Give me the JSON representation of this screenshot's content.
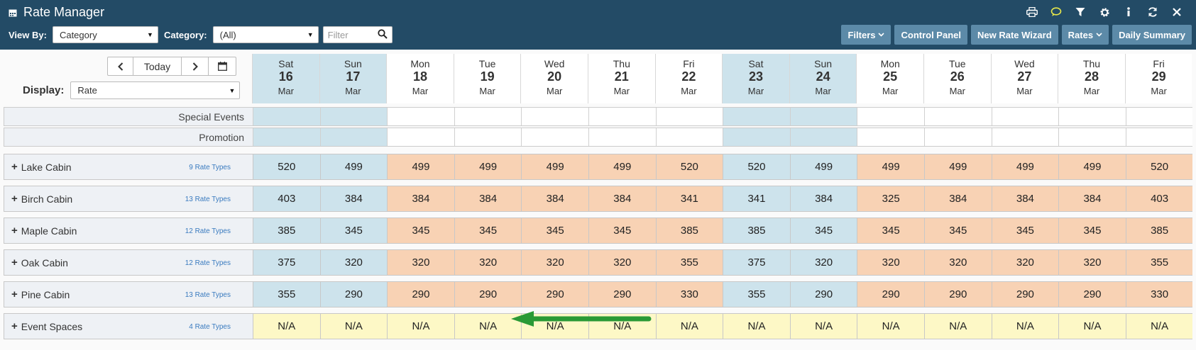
{
  "header": {
    "title": "Rate Manager",
    "view_by_label": "View By:",
    "view_by_value": "Category",
    "category_label": "Category:",
    "category_value": "(All)",
    "filter_placeholder": "Filter",
    "buttons": {
      "filters": "Filters",
      "control_panel": "Control Panel",
      "new_rate_wizard": "New Rate Wizard",
      "rates": "Rates",
      "daily_summary": "Daily Summary"
    },
    "icons": [
      "print-icon",
      "chat-icon",
      "filter-icon",
      "gear-icon",
      "info-icon",
      "refresh-icon",
      "close-icon"
    ]
  },
  "nav": {
    "today": "Today"
  },
  "display": {
    "label": "Display:",
    "value": "Rate"
  },
  "days": [
    {
      "dow": "Sat",
      "date": "16",
      "month": "Mar",
      "weekend": true
    },
    {
      "dow": "Sun",
      "date": "17",
      "month": "Mar",
      "weekend": true
    },
    {
      "dow": "Mon",
      "date": "18",
      "month": "Mar",
      "weekend": false
    },
    {
      "dow": "Tue",
      "date": "19",
      "month": "Mar",
      "weekend": false
    },
    {
      "dow": "Wed",
      "date": "20",
      "month": "Mar",
      "weekend": false
    },
    {
      "dow": "Thu",
      "date": "21",
      "month": "Mar",
      "weekend": false
    },
    {
      "dow": "Fri",
      "date": "22",
      "month": "Mar",
      "weekend": false
    },
    {
      "dow": "Sat",
      "date": "23",
      "month": "Mar",
      "weekend": true
    },
    {
      "dow": "Sun",
      "date": "24",
      "month": "Mar",
      "weekend": true
    },
    {
      "dow": "Mon",
      "date": "25",
      "month": "Mar",
      "weekend": false
    },
    {
      "dow": "Tue",
      "date": "26",
      "month": "Mar",
      "weekend": false
    },
    {
      "dow": "Wed",
      "date": "27",
      "month": "Mar",
      "weekend": false
    },
    {
      "dow": "Thu",
      "date": "28",
      "month": "Mar",
      "weekend": false
    },
    {
      "dow": "Fri",
      "date": "29",
      "month": "Mar",
      "weekend": false
    }
  ],
  "event_rows": [
    "Special Events",
    "Promotion"
  ],
  "categories": [
    {
      "name": "Lake Cabin",
      "rate_types": "9 Rate Types",
      "values": [
        "520",
        "499",
        "499",
        "499",
        "499",
        "499",
        "520",
        "520",
        "499",
        "499",
        "499",
        "499",
        "499",
        "520"
      ]
    },
    {
      "name": "Birch Cabin",
      "rate_types": "13 Rate Types",
      "values": [
        "403",
        "384",
        "384",
        "384",
        "384",
        "384",
        "341",
        "341",
        "384",
        "325",
        "384",
        "384",
        "384",
        "403"
      ]
    },
    {
      "name": "Maple Cabin",
      "rate_types": "12 Rate Types",
      "values": [
        "385",
        "345",
        "345",
        "345",
        "345",
        "345",
        "385",
        "385",
        "345",
        "345",
        "345",
        "345",
        "345",
        "385"
      ]
    },
    {
      "name": "Oak Cabin",
      "rate_types": "12 Rate Types",
      "values": [
        "375",
        "320",
        "320",
        "320",
        "320",
        "320",
        "355",
        "375",
        "320",
        "320",
        "320",
        "320",
        "320",
        "355"
      ]
    },
    {
      "name": "Pine Cabin",
      "rate_types": "13 Rate Types",
      "values": [
        "355",
        "290",
        "290",
        "290",
        "290",
        "290",
        "330",
        "355",
        "290",
        "290",
        "290",
        "290",
        "290",
        "330"
      ]
    },
    {
      "name": "Event Spaces",
      "rate_types": "4 Rate Types",
      "na": true,
      "values": [
        "N/A",
        "N/A",
        "N/A",
        "N/A",
        "N/A",
        "N/A",
        "N/A",
        "N/A",
        "N/A",
        "N/A",
        "N/A",
        "N/A",
        "N/A",
        "N/A"
      ]
    }
  ],
  "colors": {
    "header_bg": "#234b66",
    "button_bg": "#5c8aa8",
    "weekend_bg": "#cde3ec",
    "weekday_bg": "#f8d2b4",
    "na_bg": "#fdf8c6",
    "arrow": "#2a9a36"
  }
}
